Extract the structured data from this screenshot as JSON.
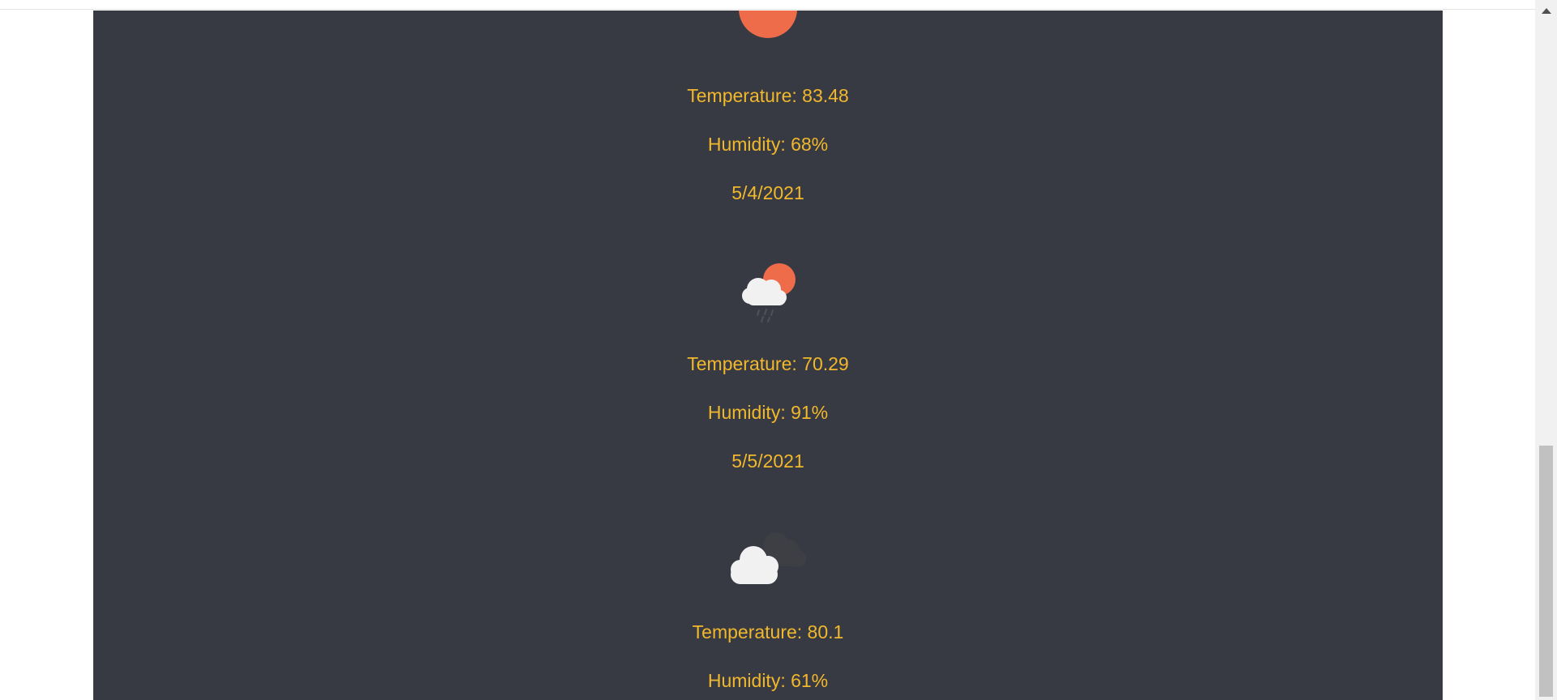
{
  "colors": {
    "panel_bg": "#373a42",
    "text_accent": "#f2b82c",
    "sun": "#ef6c4a",
    "cloud_light": "#f1f1f1",
    "cloud_dark": "#3d3f45"
  },
  "forecast": [
    {
      "icon": "sun-icon",
      "temperature": "Temperature: 83.48",
      "humidity": "Humidity: 68%",
      "date": "5/4/2021"
    },
    {
      "icon": "sun-cloud-rain-icon",
      "temperature": "Temperature: 70.29",
      "humidity": "Humidity: 91%",
      "date": "5/5/2021"
    },
    {
      "icon": "broken-clouds-icon",
      "temperature": "Temperature: 80.1",
      "humidity": "Humidity: 61%"
    }
  ]
}
